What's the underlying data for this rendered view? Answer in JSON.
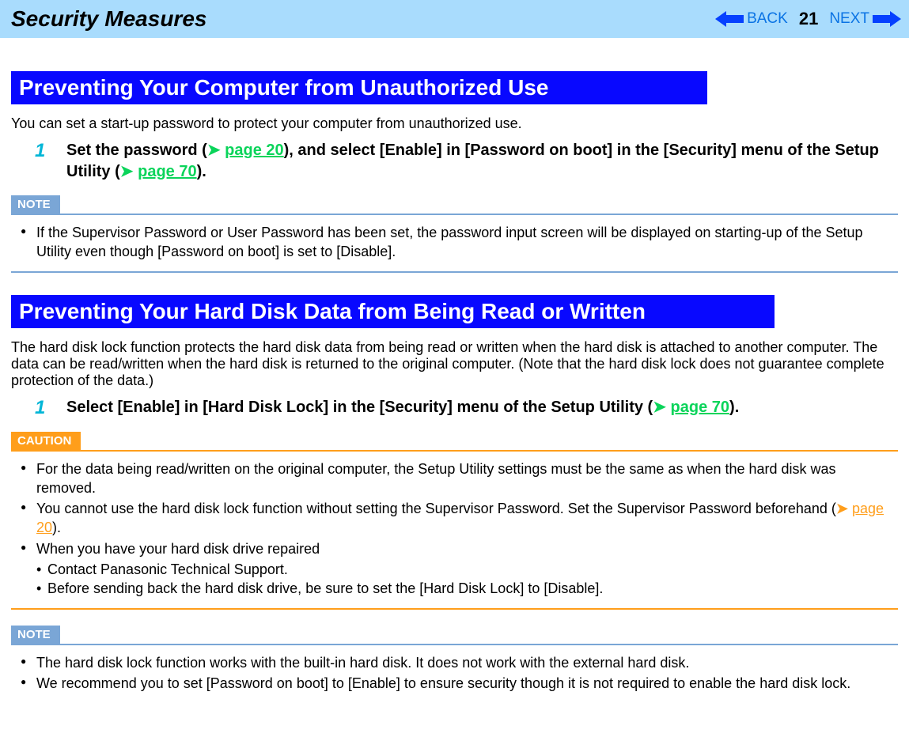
{
  "header": {
    "title": "Security Measures",
    "back_label": "BACK",
    "next_label": "NEXT",
    "page_number": "21"
  },
  "section1": {
    "heading": "Preventing Your Computer from Unauthorized Use",
    "intro": "You can set a start-up password to protect your computer from unauthorized use.",
    "step_num": "1",
    "step_text_a": "Set the password (",
    "step_link1": "page 20",
    "step_text_b": "), and select [Enable] in [Password on boot] in the [Security] menu of the Setup Utility (",
    "step_link2": "page 70",
    "step_text_c": ").",
    "note_label": "NOTE",
    "note_bullet1": "If the Supervisor Password or User Password has been set, the password input screen will be displayed on starting-up of the Setup Utility even though [Password on boot] is set to [Disable]."
  },
  "section2": {
    "heading": "Preventing Your Hard Disk Data from Being Read or Written",
    "intro": "The hard disk lock function protects the hard disk data from being read or written when the hard disk is attached to another computer. The data can be read/written when the hard disk is returned to the original computer. (Note that the hard disk lock does not guarantee complete protection of the data.)",
    "step_num": "1",
    "step_text_a": "Select [Enable] in [Hard Disk Lock] in the [Security] menu of the Setup Utility (",
    "step_link1": "page 70",
    "step_text_b": ").",
    "caution_label": "CAUTION",
    "caution_b1": "For the data being read/written on the original computer, the Setup Utility settings must be the same as when the hard disk was removed.",
    "caution_b2_a": "You cannot use the hard disk lock function without setting the Supervisor Password. Set the Supervisor Password beforehand (",
    "caution_b2_link": "page 20",
    "caution_b2_b": ").",
    "caution_b3": "When you have your hard disk drive repaired",
    "caution_b3_sub1": "Contact Panasonic Technical Support.",
    "caution_b3_sub2": "Before sending back the hard disk drive, be sure to set the [Hard Disk Lock] to [Disable].",
    "note_label": "NOTE",
    "note_b1": "The hard disk lock function works with the built-in hard disk. It does not work with the external hard disk.",
    "note_b2": "We recommend you to set [Password on boot] to [Enable] to ensure security though it is not required to enable the hard disk lock."
  }
}
